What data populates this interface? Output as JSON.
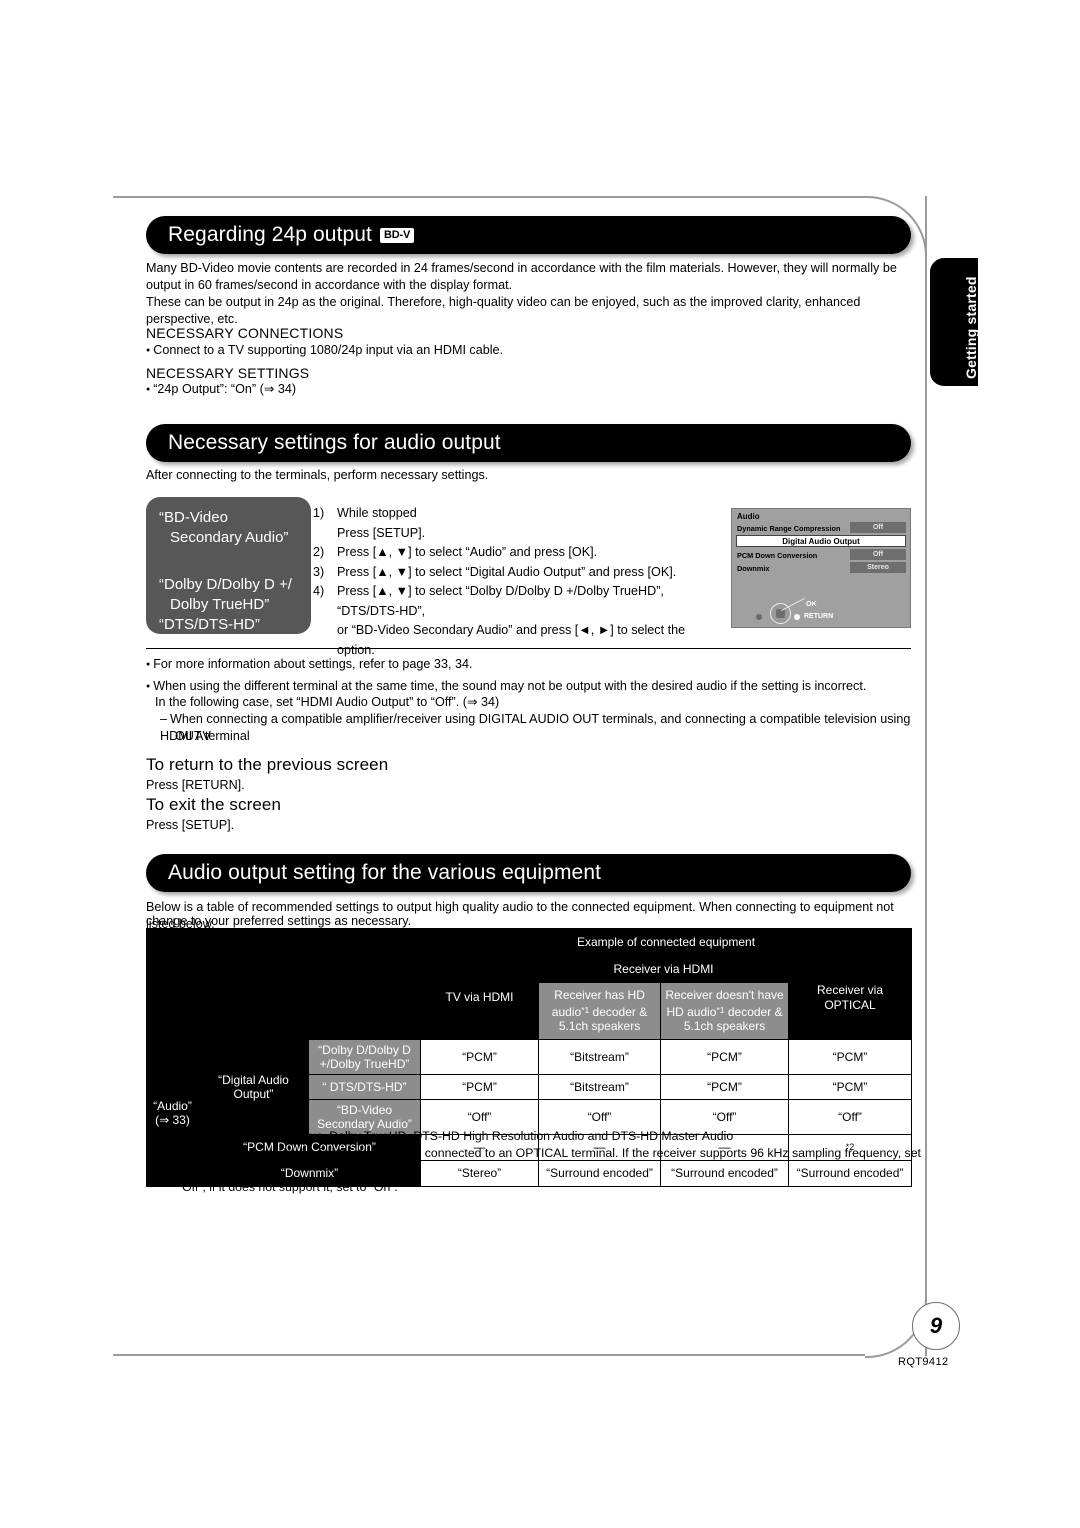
{
  "page": {
    "number": "9",
    "doc_code": "RQT9412",
    "side_tab": "Getting started"
  },
  "section1": {
    "heading": "Regarding 24p output",
    "badge": "BD-V",
    "para1": "Many BD-Video movie contents are recorded in 24 frames/second in accordance with the film materials. However, they will normally be output in 60 frames/second in accordance with the display format.",
    "para2": "These can be output in 24p as the original. Therefore, high-quality video can be enjoyed, such as the improved clarity, enhanced perspective, etc.",
    "sub1": "NECESSARY CONNECTIONS",
    "sub1_bullet": "Connect to a TV supporting 1080/24p input via an HDMI cable.",
    "sub2": "NECESSARY SETTINGS",
    "sub2_bullet": "“24p Output”: “On” (⇒ 34)"
  },
  "section2": {
    "heading": "Necessary settings for audio output",
    "intro": "After connecting to the terminals, perform necessary settings.",
    "callout": {
      "line1": "“BD-Video",
      "line2": "Secondary Audio”",
      "line3": "“Dolby D/Dolby D +/",
      "line4": "Dolby TrueHD”",
      "line5": "“DTS/DTS-HD”"
    },
    "steps": [
      {
        "num": "1)",
        "line1": "While stopped",
        "line2": "Press [SETUP]."
      },
      {
        "num": "2)",
        "line1": "Press [▲, ▼] to select “Audio” and press [OK].",
        "line2": ""
      },
      {
        "num": "3)",
        "line1": "Press [▲, ▼] to select “Digital Audio Output” and press [OK].",
        "line2": ""
      },
      {
        "num": "4)",
        "line1": "Press [▲, ▼] to select “Dolby D/Dolby D +/Dolby TrueHD”, “DTS/DTS-HD”,",
        "line2": "or “BD-Video Secondary Audio” and press [◄, ►] to select the option."
      }
    ],
    "osd": {
      "title": "Audio",
      "rows": [
        {
          "label": "Dynamic Range Compression",
          "value": "Off"
        },
        {
          "label": "PCM Down Conversion",
          "value": "Off"
        },
        {
          "label": "Downmix",
          "value": "Stereo"
        }
      ],
      "selected": "Digital Audio Output",
      "ok_label": "OK",
      "return_label": "RETURN"
    },
    "notes": [
      "For more information about settings, refer to page 33, 34.",
      "When using the different terminal at the same time, the sound may not be output with the desired audio if the setting is incorrect."
    ],
    "note2_cont": "In the following case, set “HDMI Audio Output” to “Off”. (⇒ 34)",
    "note2_dash1": "When connecting a compatible amplifier/receiver using DIGITAL AUDIO OUT terminals, and connecting a compatible television using HDMI AV",
    "note2_dash2": "OUT terminal",
    "return_head": "To return to the previous screen",
    "return_body": "Press [RETURN].",
    "exit_head": "To exit the screen",
    "exit_body": "Press [SETUP]."
  },
  "section3": {
    "heading": "Audio output setting for the various equipment",
    "intro_line1": "Below is a table of recommended settings to output high quality audio to the connected equipment. When connecting to equipment not listed below,",
    "intro_line2": "change to your preferred settings as necessary.",
    "table": {
      "group_header": "Example of connected equipment",
      "receiver_group": "Receiver via HDMI",
      "columns": [
        "TV via HDMI",
        "Receiver has HD audio*1 decoder & 5.1ch speakers",
        "Receiver doesn't have HD audio*1 decoder & 5.1ch speakers",
        "Receiver via OPTICAL"
      ],
      "col_tv": "TV via HDMI",
      "col_has_l1": "Receiver has HD",
      "col_has_l2": "audio",
      "col_has_l2b": " decoder &",
      "col_has_l3": "5.1ch speakers",
      "col_not_l1": "Receiver doesn't have",
      "col_not_l2": "HD audio",
      "col_not_l2b": " decoder &",
      "col_not_l3": "5.1ch speakers",
      "col_optical": "Receiver via OPTICAL",
      "row_group_audio_l1": "“Audio”",
      "row_group_audio_l2": "(⇒ 33)",
      "row_group_dao_l1": "“Digital Audio",
      "row_group_dao_l2": "Output”",
      "rows": [
        {
          "label_l1": "“Dolby D/Dolby D",
          "label_l2": "+/Dolby TrueHD”",
          "values": [
            "“PCM”",
            "“Bitstream”",
            "“PCM”",
            "“PCM”"
          ]
        },
        {
          "label_l1": "“ DTS/DTS-HD”",
          "label_l2": "",
          "values": [
            "“PCM”",
            "“Bitstream”",
            "“PCM”",
            "“PCM”"
          ]
        },
        {
          "label_l1": "“BD-Video",
          "label_l2": "Secondary Audio”",
          "values": [
            "“Off”",
            "“Off”",
            "“Off”",
            "“Off”"
          ]
        }
      ],
      "row_pcm_label": "“PCM Down Conversion”",
      "row_pcm_values": [
        "—",
        "—",
        "—",
        "*2"
      ],
      "row_downmix_label": "“Downmix”",
      "row_downmix_values": [
        "“Stereo”",
        "“Surround encoded”",
        "“Surround encoded”",
        "“Surround encoded”"
      ]
    },
    "footnote1_mark": "*1",
    "footnote1": "HD audio: Dolby Digital Plus, Dolby TrueHD, DTS-HD High Resolution Audio and DTS-HD Master Audio",
    "footnote2_mark": "*2",
    "footnote2_l1": "“PCM Down Conversion” is in effect only when connected to an OPTICAL terminal. If the receiver supports 96 kHz sampling frequency, set to",
    "footnote2_l2": "“Off”; if it does not support it, set to “On”."
  }
}
